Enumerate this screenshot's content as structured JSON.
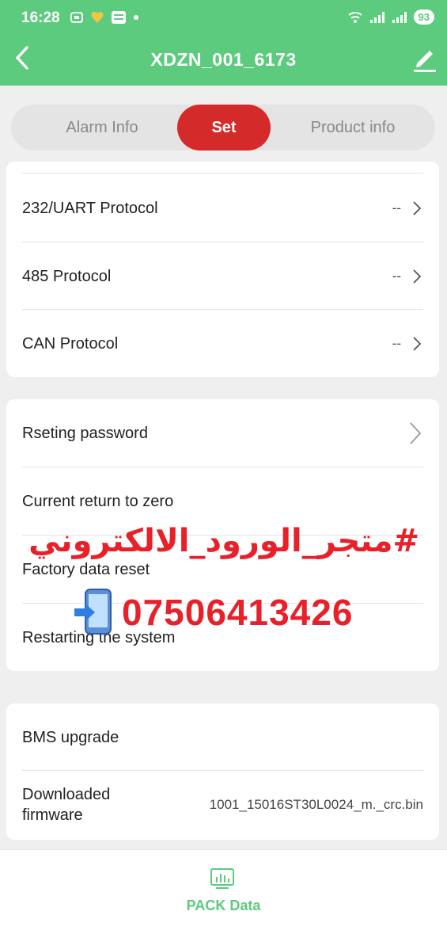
{
  "status_bar": {
    "time": "16:28",
    "battery": "93"
  },
  "header": {
    "title": "XDZN_001_6173"
  },
  "tabs": [
    {
      "label": "Alarm Info",
      "active": false
    },
    {
      "label": "Set",
      "active": true
    },
    {
      "label": "Product info",
      "active": false
    }
  ],
  "protocol_items": [
    {
      "label": "232/UART Protocol",
      "value": "--"
    },
    {
      "label": "485 Protocol",
      "value": "--"
    },
    {
      "label": "CAN Protocol",
      "value": "--"
    }
  ],
  "system_items": [
    {
      "label": "Rseting password"
    },
    {
      "label": "Current return to zero"
    },
    {
      "label": "Factory data reset"
    },
    {
      "label": "Restarting the system"
    }
  ],
  "upgrade_items": [
    {
      "label": "BMS upgrade"
    },
    {
      "label": "Downloaded firmware",
      "value": "1001_15016ST30L0024_m._crc.bin"
    }
  ],
  "watermark": {
    "text": "#متجر_الورود_الالكتروني",
    "phone": "07506413426"
  },
  "bottom_nav": {
    "label": "PACK Data"
  },
  "colors": {
    "brand_green": "#5ccb7e",
    "accent_red": "#d52a2a",
    "watermark_red": "#e7202a"
  }
}
